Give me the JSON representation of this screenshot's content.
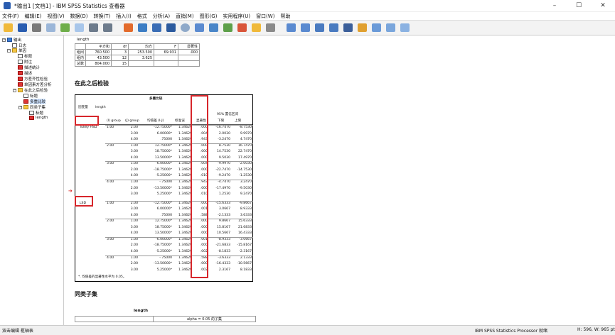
{
  "window": {
    "title": "*输出1 [文档1] - IBM SPSS Statistics 查看器",
    "min": "–",
    "max": "☐",
    "close": "✕"
  },
  "menu": [
    "文件(F)",
    "编辑(E)",
    "视图(V)",
    "数据(D)",
    "转换(T)",
    "插入(I)",
    "格式",
    "分析(A)",
    "直销(M)",
    "图形(G)",
    "实用程序(U)",
    "窗口(W)",
    "帮助"
  ],
  "tree": {
    "output": "输出",
    "log": "日志",
    "oneway": "单因",
    "title": "标题",
    "notes": "附注",
    "descriptives": "描述统计",
    "desc": "描述",
    "homog": "方差齐性检验",
    "anova": "单因素方差分析",
    "posthoc": "在此之后检验",
    "ph_title": "标题",
    "multiple": "多重比较",
    "homsub": "同类子集",
    "hs_title": "标题",
    "length": "length"
  },
  "anova_top": {
    "label": "length",
    "headers": [
      "",
      "平方和",
      "df",
      "均方",
      "F",
      "显著性"
    ],
    "rows": [
      [
        "组间",
        "760.500",
        "3",
        "253.500",
        "69.931",
        ".000"
      ],
      [
        "组内",
        "43.500",
        "12",
        "3.625",
        "",
        ""
      ],
      [
        "总数",
        "804.000",
        "15",
        "",
        "",
        ""
      ]
    ]
  },
  "posthoc_heading": "在此之后检验",
  "mc": {
    "title": "多重比较",
    "dep_label": "因变量",
    "dep_value": "length",
    "col_i": "(I) group",
    "col_j": "(J) group",
    "col_mean": "均值差 (I-J)",
    "col_se": "标准误",
    "col_sig": "显著性",
    "col_ci": "95% 置信区间",
    "col_lo": "下限",
    "col_hi": "上限",
    "methods": [
      "Tukey HSD",
      "LSD"
    ],
    "rows": [
      [
        "1.00",
        "2.00",
        "-12.75000*",
        "1.34629",
        ".000",
        "-16.7470",
        "-8.7530"
      ],
      [
        "",
        "3.00",
        "6.00000*",
        "1.34629",
        ".004",
        "2.0030",
        "9.9970"
      ],
      [
        "",
        "4.00",
        ".75000",
        "1.34629",
        ".943",
        "-3.2470",
        "4.7470"
      ],
      [
        "2.00",
        "1.00",
        "12.75000*",
        "1.34629",
        ".000",
        "8.7530",
        "16.7470"
      ],
      [
        "",
        "3.00",
        "18.75000*",
        "1.34629",
        ".000",
        "14.7530",
        "22.7470"
      ],
      [
        "",
        "4.00",
        "13.50000*",
        "1.34629",
        ".000",
        "9.5030",
        "17.4970"
      ],
      [
        "3.00",
        "1.00",
        "-6.00000*",
        "1.34629",
        ".004",
        "-9.9970",
        "-2.0030"
      ],
      [
        "",
        "2.00",
        "-18.75000*",
        "1.34629",
        ".000",
        "-22.7470",
        "-14.7530"
      ],
      [
        "",
        "4.00",
        "-5.25000*",
        "1.34629",
        ".010",
        "-9.2470",
        "-1.2530"
      ],
      [
        "4.00",
        "1.00",
        "-.75000",
        "1.34629",
        ".943",
        "-4.7470",
        "3.2470"
      ],
      [
        "",
        "2.00",
        "-13.50000*",
        "1.34629",
        ".000",
        "-17.4970",
        "-9.5030"
      ],
      [
        "",
        "3.00",
        "5.25000*",
        "1.34629",
        ".010",
        "1.2530",
        "9.2470"
      ],
      [
        "1.00",
        "2.00",
        "-12.75000*",
        "1.34629",
        ".000",
        "-15.6333",
        "-9.8667"
      ],
      [
        "",
        "3.00",
        "6.00000*",
        "1.34629",
        ".001",
        "3.0667",
        "8.9333"
      ],
      [
        "",
        "4.00",
        ".75000",
        "1.34629",
        ".588",
        "-2.1333",
        "3.6333"
      ],
      [
        "2.00",
        "1.00",
        "12.75000*",
        "1.34629",
        ".000",
        "9.8667",
        "15.6333"
      ],
      [
        "",
        "3.00",
        "18.75000*",
        "1.34629",
        ".000",
        "15.8167",
        "21.6833"
      ],
      [
        "",
        "4.00",
        "13.50000*",
        "1.34629",
        ".000",
        "10.5667",
        "16.4333"
      ],
      [
        "3.00",
        "1.00",
        "-6.00000*",
        "1.34629",
        ".001",
        "-8.9333",
        "-3.0667"
      ],
      [
        "",
        "2.00",
        "-18.75000*",
        "1.34629",
        ".000",
        "-21.6833",
        "-15.8167"
      ],
      [
        "",
        "4.00",
        "-5.25000*",
        "1.34629",
        ".002",
        "-8.1833",
        "-2.3167"
      ],
      [
        "4.00",
        "1.00",
        "-.75000",
        "1.34629",
        ".588",
        "-3.6333",
        "2.1333"
      ],
      [
        "",
        "2.00",
        "-13.50000*",
        "1.34629",
        ".000",
        "-16.4333",
        "-10.5667"
      ],
      [
        "",
        "3.00",
        "5.25000*",
        "1.34629",
        ".002",
        "2.3167",
        "8.1833"
      ]
    ],
    "footnote": "*. 均值差的显著性水平为 0.05。"
  },
  "homsub_heading": "同类子集",
  "homsub_table_label": "length",
  "homsub_alpha": "alpha = 0.05 的子集",
  "status": {
    "left": "双击编辑 枢轴表",
    "right": "IBM SPSS Statistics Processor 就绪",
    "far": "H: 596, W: 965 pt"
  },
  "colors": {
    "highlight": "#d7262b",
    "accent": "#2a5db0"
  }
}
